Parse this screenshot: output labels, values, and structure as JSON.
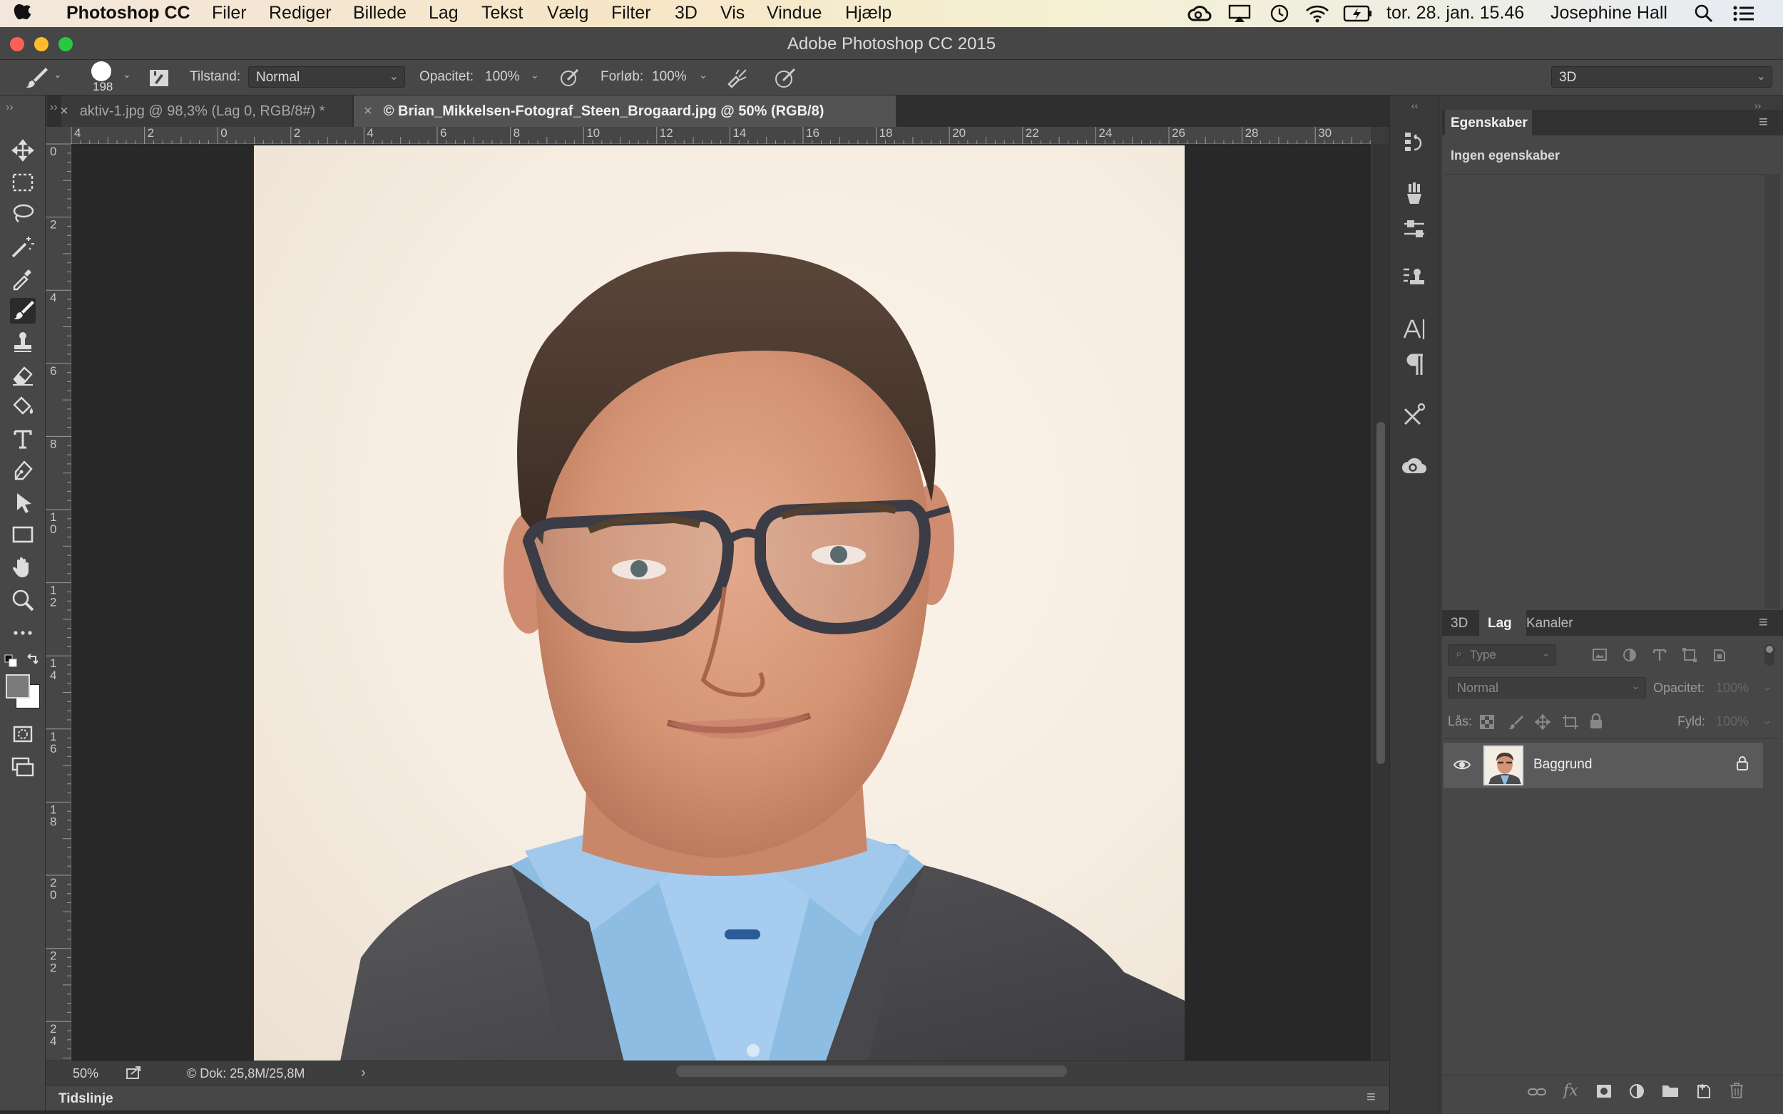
{
  "menubar": {
    "app_name": "Photoshop CC",
    "items": [
      "Filer",
      "Rediger",
      "Billede",
      "Lag",
      "Tekst",
      "Vælg",
      "Filter",
      "3D",
      "Vis",
      "Vindue",
      "Hjælp"
    ],
    "clock": "tor. 28. jan. 15.46",
    "user": "Josephine Hall"
  },
  "window": {
    "title": "Adobe Photoshop CC 2015"
  },
  "options": {
    "brush_size": "198",
    "mode_label": "Tilstand:",
    "mode_value": "Normal",
    "opacity_label": "Opacitet:",
    "opacity_value": "100%",
    "flow_label": "Forløb:",
    "flow_value": "100%",
    "workspace": "3D"
  },
  "tabs": [
    {
      "label": "aktiv-1.jpg @ 98,3% (Lag 0, RGB/8#) *",
      "active": false
    },
    {
      "label": "© Brian_Mikkelsen-Fotograf_Steen_Brogaard.jpg @ 50% (RGB/8)",
      "active": true
    }
  ],
  "ruler": {
    "h_labels": [
      "4",
      "2",
      "0",
      "2",
      "4",
      "6",
      "8",
      "10",
      "12",
      "14",
      "16",
      "18",
      "20",
      "22",
      "24",
      "26",
      "28",
      "30"
    ],
    "v_labels": [
      "0",
      "2",
      "4",
      "6",
      "8",
      "1\n0",
      "1\n2",
      "1\n4",
      "1\n6",
      "1\n8",
      "2\n0",
      "2\n2",
      "2\n4"
    ]
  },
  "status": {
    "zoom": "50%",
    "doc": "© Dok: 25,8M/25,8M"
  },
  "timeline": {
    "label": "Tidslinje"
  },
  "properties": {
    "tab": "Egenskaber",
    "empty": "Ingen egenskaber"
  },
  "layers_panel": {
    "tabs": [
      "3D",
      "Lag",
      "Kanaler"
    ],
    "active_tab": "Lag",
    "filter_placeholder": "Type",
    "blend_mode": "Normal",
    "opacity_label": "Opacitet:",
    "opacity_value": "100%",
    "lock_label": "Lås:",
    "fill_label": "Fyld:",
    "fill_value": "100%",
    "layers": [
      {
        "name": "Baggrund",
        "visible": true,
        "locked": true
      }
    ]
  },
  "colors": {
    "accent_active": "#2b2b2b",
    "panel_bg": "#3b3b3b",
    "canvas_bg": "#282828"
  }
}
